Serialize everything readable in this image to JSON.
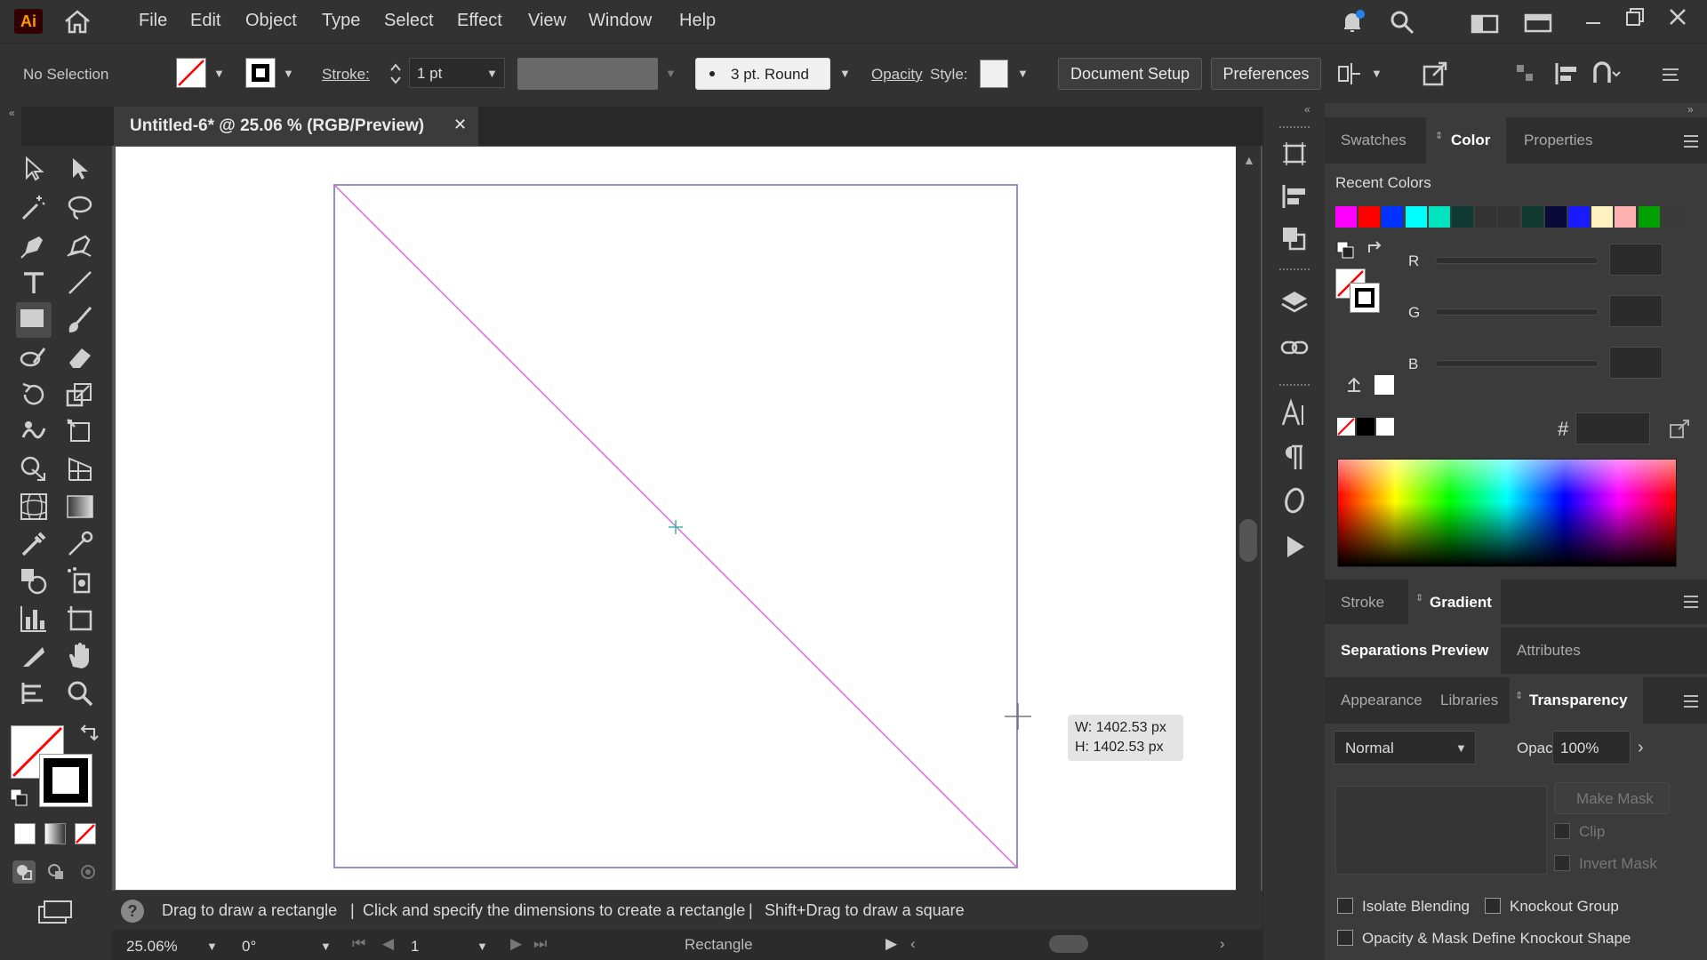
{
  "app": {
    "logo": "Ai"
  },
  "menu": [
    "File",
    "Edit",
    "Object",
    "Type",
    "Select",
    "Effect",
    "View",
    "Window",
    "Help"
  ],
  "control_bar": {
    "selection": "No Selection",
    "stroke_label": "Stroke:",
    "stroke_weight": "1 pt",
    "brush": "3 pt. Round",
    "opacity_label": "Opacity",
    "style_label": "Style:",
    "document_setup": "Document Setup",
    "preferences": "Preferences"
  },
  "document_tab": {
    "title": "Untitled-6* @ 25.06 % (RGB/Preview)",
    "close": "✕"
  },
  "tooltip": {
    "width": "W: 1402.53 px",
    "height": "H: 1402.53 px"
  },
  "status": {
    "hint_1": "Drag to draw a rectangle",
    "sep": "|",
    "hint_2": "Click and specify the dimensions to create a rectangle",
    "hint_3": "Shift+Drag to draw a square",
    "zoom": "25.06%",
    "rotation": "0°",
    "artboard": "1",
    "tool_name": "Rectangle"
  },
  "panels": {
    "group1_tabs": [
      "Swatches",
      "Color",
      "Properties"
    ],
    "recent_colors_label": "Recent Colors",
    "recent_colors": [
      "#ff00ff",
      "#ff0000",
      "#0033ff",
      "#00ffff",
      "#00e5c0",
      "#0e3a33",
      "#333333",
      "#333333",
      "#103a30",
      "#0a0a3a",
      "#1a1aff",
      "#fff2c0",
      "#ffb0b0",
      "#00a000",
      "#3a3a3a"
    ],
    "r_label": "R",
    "g_label": "G",
    "b_label": "B",
    "hex_label": "#",
    "group2_tabs": [
      "Stroke",
      "Gradient"
    ],
    "group3_tabs": [
      "Separations Preview",
      "Attributes"
    ],
    "group4_tabs": [
      "Appearance",
      "Libraries",
      "Transparency"
    ],
    "blend_mode": "Normal",
    "opacity_label": "Opacity:",
    "opacity_value": "100%",
    "make_mask": "Make Mask",
    "clip": "Clip",
    "invert_mask": "Invert Mask",
    "isolate_blending": "Isolate Blending",
    "knockout_group": "Knockout Group",
    "opacity_mask_knockout": "Opacity & Mask Define Knockout Shape"
  },
  "colors": {
    "accent_pink": "#e062e0",
    "artboard_border": "#6c6cbf",
    "chrome_dark": "#323232",
    "canvas_bg": "#535353"
  }
}
